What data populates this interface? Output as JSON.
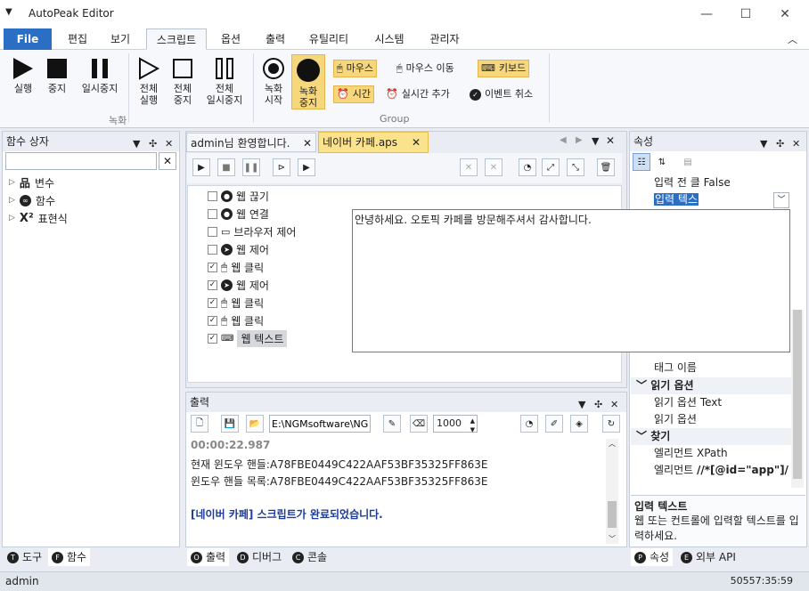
{
  "window": {
    "title": "AutoPeak Editor"
  },
  "menu": {
    "tabs": [
      "File",
      "편집",
      "보기",
      "스크립트",
      "옵션",
      "출력",
      "유틸리티",
      "시스템",
      "관리자"
    ]
  },
  "ribbon": {
    "run": "실행",
    "stop": "중지",
    "pause": "일시중지",
    "all_run_1": "전체",
    "all_run_2": "실행",
    "all_stop_1": "전체",
    "all_stop_2": "중지",
    "all_pause_1": "전체",
    "all_pause_2": "일시중지",
    "rec_start_1": "녹화",
    "rec_start_2": "시작",
    "rec_stop_1": "녹화",
    "rec_stop_2": "중지",
    "mouse_btn": "마우스",
    "mouse_move": "마우스 이동",
    "keyboard": "키보드",
    "time": "시간",
    "add_realtime": "실시간 추가",
    "cancel_event": "이벤트 취소",
    "group_record": "녹화",
    "group_group": "Group"
  },
  "func_box": {
    "title": "함수 상자",
    "items": [
      "변수",
      "함수",
      "표현식"
    ]
  },
  "editor": {
    "tabs": [
      "admin님 환영합니다.",
      "네이버 카페.aps"
    ],
    "rows": [
      {
        "label": "웹 끊기",
        "checked": false
      },
      {
        "label": "웹 연결",
        "checked": false
      },
      {
        "label": "브라우저 제어",
        "checked": false
      },
      {
        "label": "웹 제어",
        "checked": false
      },
      {
        "label": "웹 클릭",
        "checked": true
      },
      {
        "label": "웹 제어",
        "checked": true
      },
      {
        "label": "웹 클릭",
        "checked": true
      },
      {
        "label": "웹 클릭",
        "checked": true
      },
      {
        "label": "웹 텍스트",
        "checked": true
      }
    ],
    "popup_text": "안녕하세요. 오토픽 카페를 방문해주셔서 감사합니다."
  },
  "output": {
    "title": "출력",
    "path": "E:\\NGMsoftware\\NG",
    "count": "1000",
    "lines": [
      "00:00:22.987",
      "현재 윈도우 핸들:A78FBE0449C422AAF53BF35325FF863E",
      "윈도우 핸들 목록:A78FBE0449C422AAF53BF35325FF863E",
      "",
      "[네이버 카페] 스크립트가 완료되었습니다."
    ]
  },
  "properties": {
    "title": "속성",
    "rows": [
      {
        "k": "입력 전 클",
        "v": "False"
      },
      {
        "k": "입력 텍스",
        "v": ""
      }
    ],
    "lower": [
      {
        "k": "태그 이름",
        "v": ""
      },
      {
        "k": "읽기 옵션",
        "v": "",
        "section": true
      },
      {
        "k": "읽기 옵션",
        "v": "Text"
      },
      {
        "k": "읽기 옵션",
        "v": ""
      },
      {
        "k": "찾기",
        "v": "",
        "section": true
      },
      {
        "k": "엘리먼트",
        "v": "XPath"
      },
      {
        "k": "엘리먼트",
        "v": "//*[@id=\"app\"]/"
      }
    ],
    "desc_title": "입력 텍스트",
    "desc_body": "웹 또는 컨트롤에 입력할 텍스트를 입력하세요."
  },
  "bottom_tabs": {
    "left": [
      "도구",
      "함수"
    ],
    "center": [
      "출력",
      "디버그",
      "콘솔"
    ],
    "right": [
      "속성",
      "외부 API"
    ]
  },
  "status": {
    "user": "admin",
    "time": "50557:35:59"
  }
}
